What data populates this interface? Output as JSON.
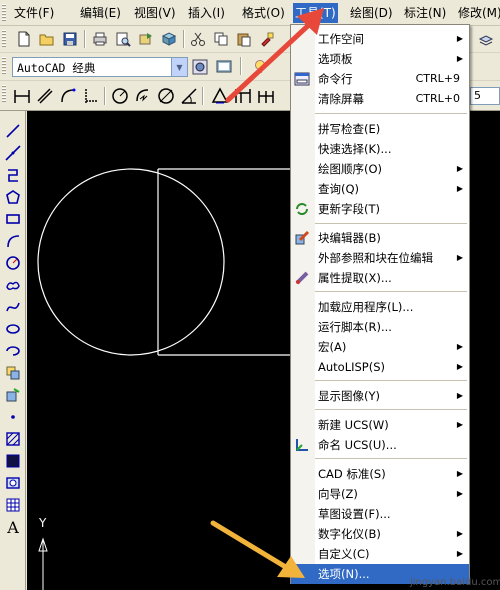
{
  "menubar": {
    "items": [
      {
        "label": "文件(F)"
      },
      {
        "label": "编辑(E)"
      },
      {
        "label": "视图(V)"
      },
      {
        "label": "插入(I)"
      },
      {
        "label": "格式(O)"
      },
      {
        "label": "工具(T)"
      },
      {
        "label": "绘图(D)"
      },
      {
        "label": "标注(N)"
      },
      {
        "label": "修改(M)"
      }
    ],
    "active_index": 5
  },
  "toolbar": {
    "workspace_value": "AutoCAD 经典",
    "field_value": "5"
  },
  "canvas": {
    "axis_label": "Y"
  },
  "tools_menu": {
    "items": [
      {
        "label": "工作空间",
        "shortcut": "",
        "submenu": true,
        "icon": ""
      },
      {
        "label": "选项板",
        "shortcut": "",
        "submenu": true,
        "icon": ""
      },
      {
        "label": "命令行",
        "shortcut": "CTRL+9",
        "submenu": false,
        "icon": "command-line-icon"
      },
      {
        "label": "清除屏幕",
        "shortcut": "CTRL+0",
        "submenu": false,
        "icon": ""
      },
      {
        "label": "拼写检查(E)",
        "shortcut": "",
        "submenu": false,
        "icon": ""
      },
      {
        "label": "快速选择(K)...",
        "shortcut": "",
        "submenu": false,
        "icon": ""
      },
      {
        "label": "绘图顺序(O)",
        "shortcut": "",
        "submenu": true,
        "icon": ""
      },
      {
        "label": "查询(Q)",
        "shortcut": "",
        "submenu": true,
        "icon": ""
      },
      {
        "label": "更新字段(T)",
        "shortcut": "",
        "submenu": false,
        "icon": "update-field-icon"
      },
      {
        "label": "块编辑器(B)",
        "shortcut": "",
        "submenu": false,
        "icon": "block-editor-icon"
      },
      {
        "label": "外部参照和块在位编辑",
        "shortcut": "",
        "submenu": true,
        "icon": ""
      },
      {
        "label": "属性提取(X)...",
        "shortcut": "",
        "submenu": false,
        "icon": "attribute-extract-icon"
      },
      {
        "label": "加载应用程序(L)...",
        "shortcut": "",
        "submenu": false,
        "icon": ""
      },
      {
        "label": "运行脚本(R)...",
        "shortcut": "",
        "submenu": false,
        "icon": ""
      },
      {
        "label": "宏(A)",
        "shortcut": "",
        "submenu": true,
        "icon": ""
      },
      {
        "label": "AutoLISP(S)",
        "shortcut": "",
        "submenu": true,
        "icon": ""
      },
      {
        "label": "显示图像(Y)",
        "shortcut": "",
        "submenu": true,
        "icon": ""
      },
      {
        "label": "新建 UCS(W)",
        "shortcut": "",
        "submenu": true,
        "icon": ""
      },
      {
        "label": "命名 UCS(U)...",
        "shortcut": "",
        "submenu": false,
        "icon": "named-ucs-icon"
      },
      {
        "label": "CAD 标准(S)",
        "shortcut": "",
        "submenu": true,
        "icon": ""
      },
      {
        "label": "向导(Z)",
        "shortcut": "",
        "submenu": true,
        "icon": ""
      },
      {
        "label": "草图设置(F)...",
        "shortcut": "",
        "submenu": false,
        "icon": ""
      },
      {
        "label": "数字化仪(B)",
        "shortcut": "",
        "submenu": true,
        "icon": ""
      },
      {
        "label": "自定义(C)",
        "shortcut": "",
        "submenu": true,
        "icon": ""
      },
      {
        "label": "选项(N)...",
        "shortcut": "",
        "submenu": false,
        "icon": ""
      }
    ],
    "highlighted_index": 24
  },
  "watermark": {
    "text": "jingyan.baidu.com"
  },
  "colors": {
    "highlight": "#316ac5",
    "annotation_arrow": "#e8483a",
    "pointer_arrow": "#f2b33b"
  }
}
